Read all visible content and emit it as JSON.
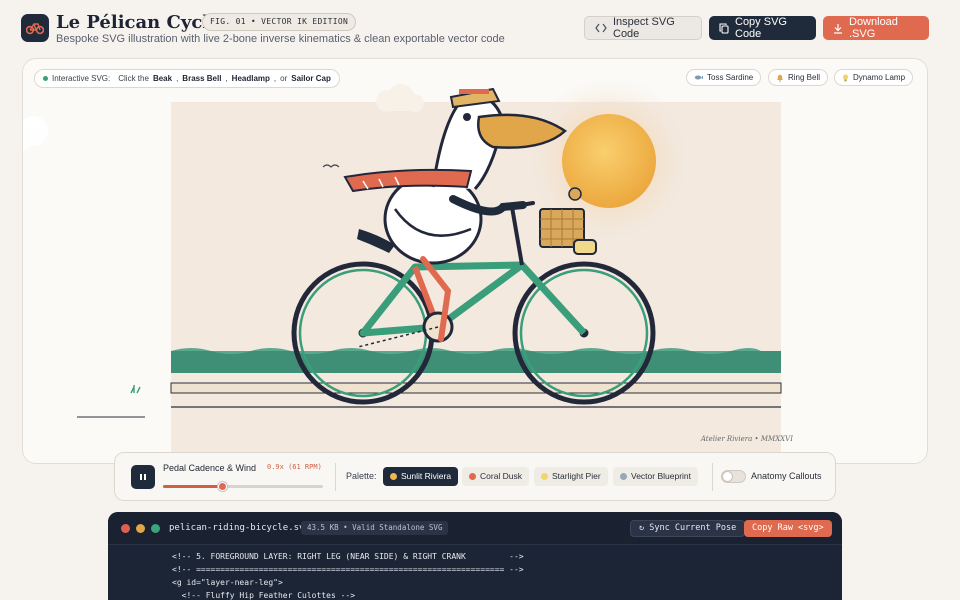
{
  "header": {
    "title": "Le Pélican Cycliste",
    "fig_badge": "FIG. 01 • VECTOR IK EDITION",
    "subtitle": "Bespoke SVG illustration with live 2-bone inverse kinematics & clean exportable vector code",
    "buttons": {
      "inspect": "Inspect SVG Code",
      "copy": "Copy SVG Code",
      "download": "Download .SVG"
    }
  },
  "stage": {
    "hint": {
      "label": "Interactive SVG:",
      "prefix": "Click the",
      "beak": "Beak",
      "bell": "Brass Bell",
      "lamp": "Headlamp",
      "or": "or",
      "cap": "Sailor Cap"
    },
    "actions": [
      {
        "label": "Toss Sardine",
        "icon": "fish-icon"
      },
      {
        "label": "Ring Bell",
        "icon": "bell-icon"
      },
      {
        "label": "Dynamo Lamp",
        "icon": "bulb-icon"
      }
    ],
    "credit": "Atelier Riviera • MMXXVI"
  },
  "controls": {
    "cadence_label": "Pedal Cadence & Wind",
    "cadence_value": "0.9x (61 RPM)",
    "cadence_level": 0.37,
    "palette_label": "Palette:",
    "palettes": [
      {
        "label": "Sunlit Riviera",
        "active": true,
        "color": "#f2b74a"
      },
      {
        "label": "Coral Dusk",
        "active": false,
        "color": "#e06a50"
      },
      {
        "label": "Starlight Pier",
        "active": false,
        "color": "#f3d36b"
      },
      {
        "label": "Vector Blueprint",
        "active": false,
        "color": "#9aa6b8"
      }
    ],
    "callouts_label": "Anatomy Callouts",
    "callouts_on": false
  },
  "code": {
    "filename": "pelican-riding-bicycle.svg",
    "meta": "43.5 KB • Valid Standalone SVG",
    "sync": "↻ Sync Current Pose",
    "copy_raw": "Copy Raw <svg>",
    "lines": [
      "<!-- 5. FOREGROUND LAYER: RIGHT LEG (NEAR SIDE) & RIGHT CRANK         -->",
      "<!-- ================================================================ -->",
      "<g id=\"layer-near-leg\">",
      "  <!-- Fluffy Hip Feather Culottes -->"
    ]
  },
  "colors": {
    "navy": "#1f2a3b",
    "coral": "#e06a50",
    "teal": "#3a9e7a",
    "sun": "#f2b74a"
  }
}
